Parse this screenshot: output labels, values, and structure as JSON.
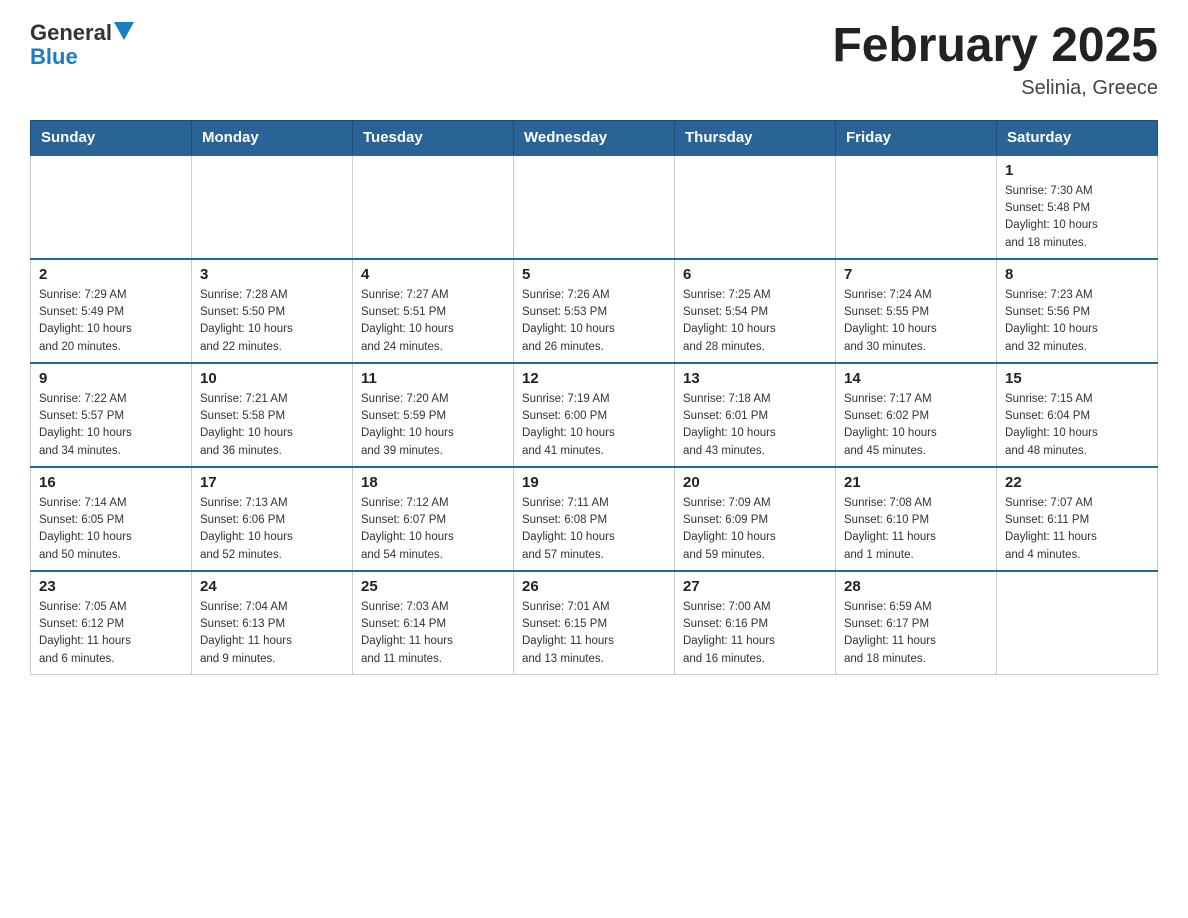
{
  "header": {
    "logo": {
      "general": "General",
      "blue": "Blue",
      "arrow": "▼"
    },
    "title": "February 2025",
    "location": "Selinia, Greece"
  },
  "weekdays": [
    "Sunday",
    "Monday",
    "Tuesday",
    "Wednesday",
    "Thursday",
    "Friday",
    "Saturday"
  ],
  "weeks": [
    {
      "days": [
        {
          "number": "",
          "info": "",
          "empty": true
        },
        {
          "number": "",
          "info": "",
          "empty": true
        },
        {
          "number": "",
          "info": "",
          "empty": true
        },
        {
          "number": "",
          "info": "",
          "empty": true
        },
        {
          "number": "",
          "info": "",
          "empty": true
        },
        {
          "number": "",
          "info": "",
          "empty": true
        },
        {
          "number": "1",
          "info": "Sunrise: 7:30 AM\nSunset: 5:48 PM\nDaylight: 10 hours\nand 18 minutes.",
          "empty": false
        }
      ]
    },
    {
      "days": [
        {
          "number": "2",
          "info": "Sunrise: 7:29 AM\nSunset: 5:49 PM\nDaylight: 10 hours\nand 20 minutes.",
          "empty": false
        },
        {
          "number": "3",
          "info": "Sunrise: 7:28 AM\nSunset: 5:50 PM\nDaylight: 10 hours\nand 22 minutes.",
          "empty": false
        },
        {
          "number": "4",
          "info": "Sunrise: 7:27 AM\nSunset: 5:51 PM\nDaylight: 10 hours\nand 24 minutes.",
          "empty": false
        },
        {
          "number": "5",
          "info": "Sunrise: 7:26 AM\nSunset: 5:53 PM\nDaylight: 10 hours\nand 26 minutes.",
          "empty": false
        },
        {
          "number": "6",
          "info": "Sunrise: 7:25 AM\nSunset: 5:54 PM\nDaylight: 10 hours\nand 28 minutes.",
          "empty": false
        },
        {
          "number": "7",
          "info": "Sunrise: 7:24 AM\nSunset: 5:55 PM\nDaylight: 10 hours\nand 30 minutes.",
          "empty": false
        },
        {
          "number": "8",
          "info": "Sunrise: 7:23 AM\nSunset: 5:56 PM\nDaylight: 10 hours\nand 32 minutes.",
          "empty": false
        }
      ]
    },
    {
      "days": [
        {
          "number": "9",
          "info": "Sunrise: 7:22 AM\nSunset: 5:57 PM\nDaylight: 10 hours\nand 34 minutes.",
          "empty": false
        },
        {
          "number": "10",
          "info": "Sunrise: 7:21 AM\nSunset: 5:58 PM\nDaylight: 10 hours\nand 36 minutes.",
          "empty": false
        },
        {
          "number": "11",
          "info": "Sunrise: 7:20 AM\nSunset: 5:59 PM\nDaylight: 10 hours\nand 39 minutes.",
          "empty": false
        },
        {
          "number": "12",
          "info": "Sunrise: 7:19 AM\nSunset: 6:00 PM\nDaylight: 10 hours\nand 41 minutes.",
          "empty": false
        },
        {
          "number": "13",
          "info": "Sunrise: 7:18 AM\nSunset: 6:01 PM\nDaylight: 10 hours\nand 43 minutes.",
          "empty": false
        },
        {
          "number": "14",
          "info": "Sunrise: 7:17 AM\nSunset: 6:02 PM\nDaylight: 10 hours\nand 45 minutes.",
          "empty": false
        },
        {
          "number": "15",
          "info": "Sunrise: 7:15 AM\nSunset: 6:04 PM\nDaylight: 10 hours\nand 48 minutes.",
          "empty": false
        }
      ]
    },
    {
      "days": [
        {
          "number": "16",
          "info": "Sunrise: 7:14 AM\nSunset: 6:05 PM\nDaylight: 10 hours\nand 50 minutes.",
          "empty": false
        },
        {
          "number": "17",
          "info": "Sunrise: 7:13 AM\nSunset: 6:06 PM\nDaylight: 10 hours\nand 52 minutes.",
          "empty": false
        },
        {
          "number": "18",
          "info": "Sunrise: 7:12 AM\nSunset: 6:07 PM\nDaylight: 10 hours\nand 54 minutes.",
          "empty": false
        },
        {
          "number": "19",
          "info": "Sunrise: 7:11 AM\nSunset: 6:08 PM\nDaylight: 10 hours\nand 57 minutes.",
          "empty": false
        },
        {
          "number": "20",
          "info": "Sunrise: 7:09 AM\nSunset: 6:09 PM\nDaylight: 10 hours\nand 59 minutes.",
          "empty": false
        },
        {
          "number": "21",
          "info": "Sunrise: 7:08 AM\nSunset: 6:10 PM\nDaylight: 11 hours\nand 1 minute.",
          "empty": false
        },
        {
          "number": "22",
          "info": "Sunrise: 7:07 AM\nSunset: 6:11 PM\nDaylight: 11 hours\nand 4 minutes.",
          "empty": false
        }
      ]
    },
    {
      "days": [
        {
          "number": "23",
          "info": "Sunrise: 7:05 AM\nSunset: 6:12 PM\nDaylight: 11 hours\nand 6 minutes.",
          "empty": false
        },
        {
          "number": "24",
          "info": "Sunrise: 7:04 AM\nSunset: 6:13 PM\nDaylight: 11 hours\nand 9 minutes.",
          "empty": false
        },
        {
          "number": "25",
          "info": "Sunrise: 7:03 AM\nSunset: 6:14 PM\nDaylight: 11 hours\nand 11 minutes.",
          "empty": false
        },
        {
          "number": "26",
          "info": "Sunrise: 7:01 AM\nSunset: 6:15 PM\nDaylight: 11 hours\nand 13 minutes.",
          "empty": false
        },
        {
          "number": "27",
          "info": "Sunrise: 7:00 AM\nSunset: 6:16 PM\nDaylight: 11 hours\nand 16 minutes.",
          "empty": false
        },
        {
          "number": "28",
          "info": "Sunrise: 6:59 AM\nSunset: 6:17 PM\nDaylight: 11 hours\nand 18 minutes.",
          "empty": false
        },
        {
          "number": "",
          "info": "",
          "empty": true
        }
      ]
    }
  ]
}
